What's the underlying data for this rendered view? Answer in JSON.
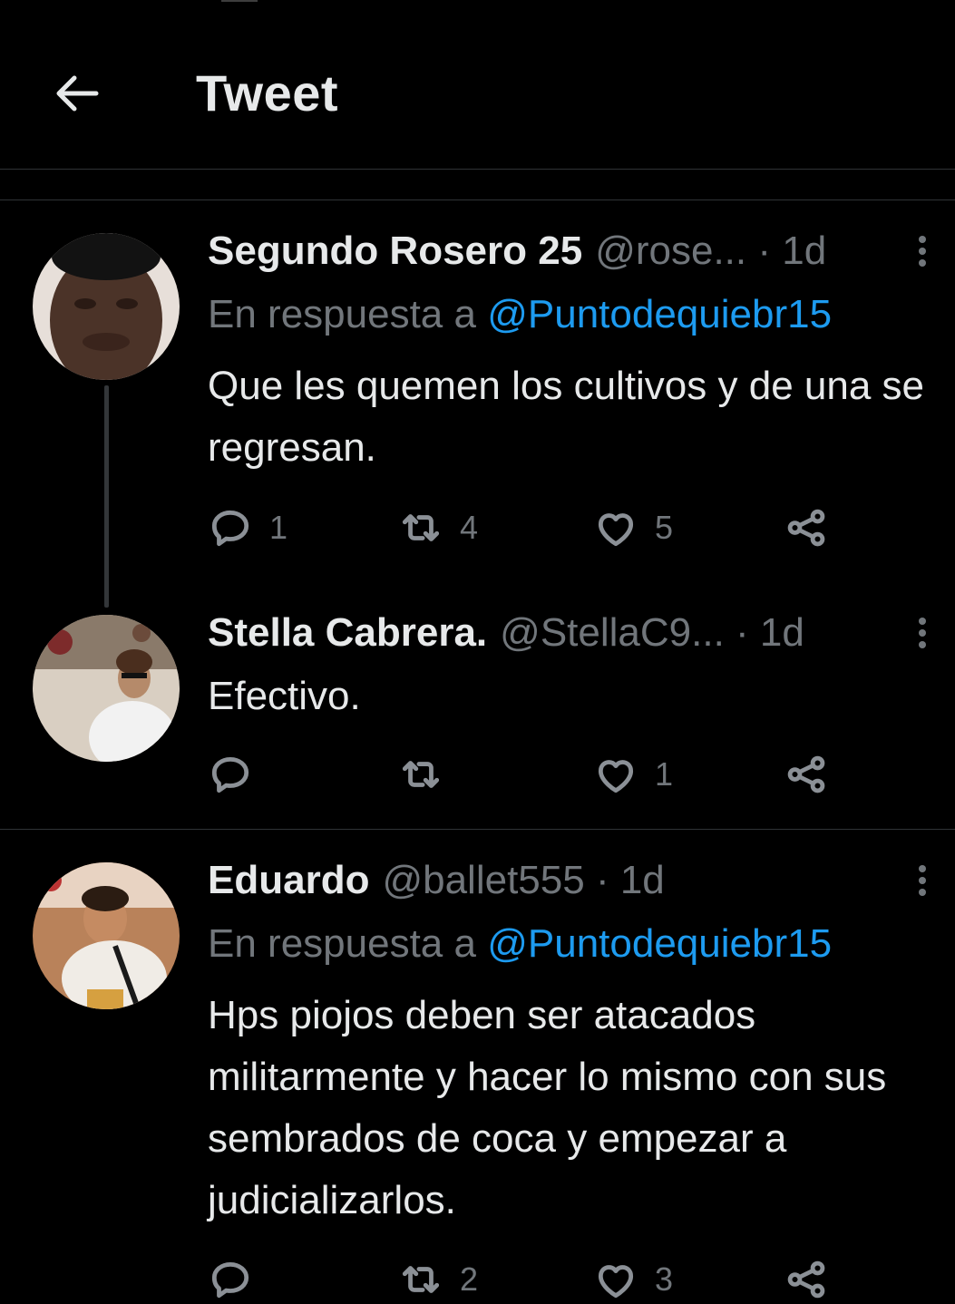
{
  "header": {
    "title": "Tweet"
  },
  "reply_prefix": "En respuesta a",
  "tweets": [
    {
      "name": "Segundo Rosero 25",
      "handle": "@rose...",
      "time": "· 1d",
      "reply_to": "@Puntodequiebr15",
      "text": "Que les quemen los cultivos y de una se regresan.",
      "replies": "1",
      "retweets": "4",
      "likes": "5"
    },
    {
      "name": "Stella Cabrera.",
      "handle": "@StellaC9...",
      "time": "· 1d",
      "text": "Efectivo.",
      "replies": "",
      "retweets": "",
      "likes": "1"
    },
    {
      "name": "Eduardo",
      "handle": "@ballet555",
      "time": "· 1d",
      "reply_to": "@Puntodequiebr15",
      "text": "Hps piojos deben ser atacados militarmente y hacer lo mismo con sus sembrados de coca y empezar a judicializarlos.",
      "replies": "",
      "retweets": "2",
      "likes": "3"
    }
  ],
  "colors": {
    "background": "#000000",
    "text": "#e7e9ea",
    "muted": "#71767b",
    "link": "#1d9bf0",
    "divider": "#2f3336"
  },
  "icons": [
    "arrow-left-icon",
    "reply-icon",
    "retweet-icon",
    "like-icon",
    "share-icon",
    "more-icon"
  ]
}
